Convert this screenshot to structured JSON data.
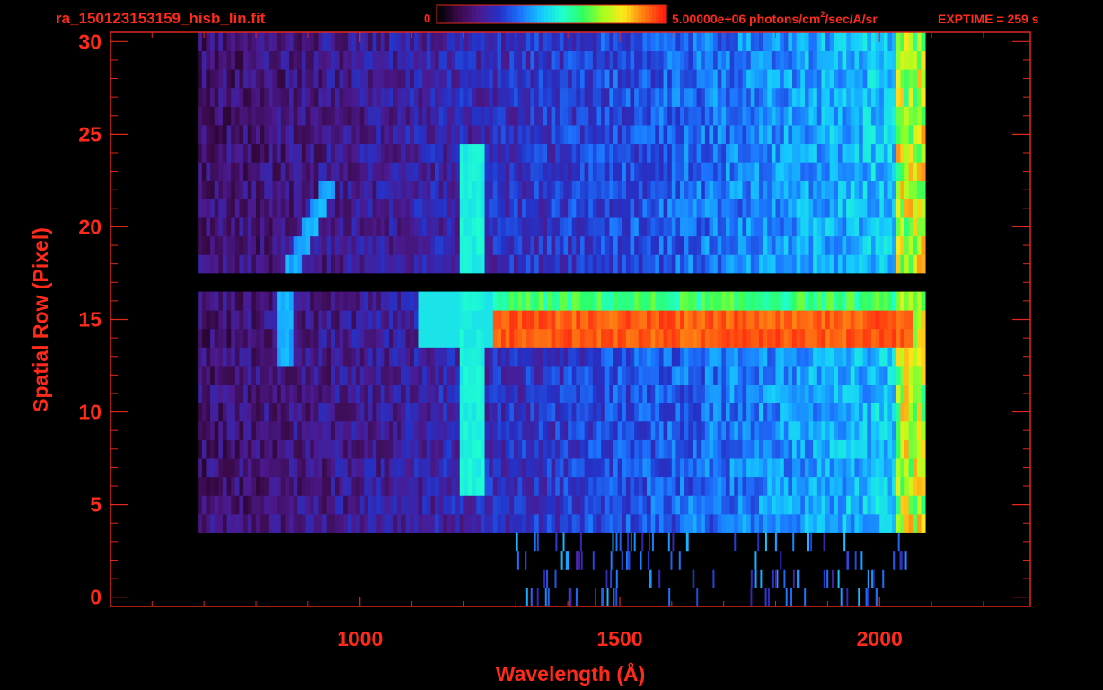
{
  "header": {
    "filename": "ra_150123153159_hisb_lin.fit",
    "colorbar_min_label": "0",
    "colorbar_max_label": "5.00000e+06 photons/cm",
    "colorbar_unit_sup": "2",
    "colorbar_unit_rest": "/sec/A/sr",
    "exptime_label": "EXPTIME = 259 s"
  },
  "colors": {
    "text": "#ff2a1a",
    "axes": "#e0281c",
    "background": "#000000",
    "colormap": [
      "#000000",
      "#3a0a4a",
      "#4b1a90",
      "#2432c8",
      "#1c74ff",
      "#15c8ff",
      "#1fffd0",
      "#2eff62",
      "#a6ff1e",
      "#ffe81a",
      "#ff7a12",
      "#ff1c10"
    ]
  },
  "chart_data": {
    "type": "heatmap",
    "title": "ra_150123153159_hisb_lin.fit",
    "xlabel": "Wavelength (Å)",
    "ylabel": "Spatial Row (Pixel)",
    "xlim": [
      520,
      2290
    ],
    "ylim": [
      -0.5,
      30.5
    ],
    "xticks": [
      1000,
      1500,
      2000
    ],
    "yticks": [
      0,
      5,
      10,
      15,
      20,
      25,
      30
    ],
    "colorbar": {
      "min": 0,
      "max": 5000000,
      "unit": "photons/cm^2/sec/A/sr"
    },
    "exptime_s": 259,
    "data_extent": {
      "wavelength": [
        690,
        2090
      ],
      "rows": [
        4,
        30
      ]
    },
    "features": [
      {
        "type": "emission_line",
        "center": 1216,
        "rows": [
          6,
          24
        ],
        "level": 0.52
      },
      {
        "type": "emission_line_curved",
        "wavelength_range": [
          845,
          955
        ],
        "rows": [
          13,
          22
        ],
        "level": 0.42
      },
      {
        "type": "bright_band",
        "rows": [
          14,
          15
        ],
        "wavelength_range": [
          1260,
          2060
        ],
        "level": 0.98
      },
      {
        "type": "moderate_band",
        "rows": [
          16,
          16
        ],
        "wavelength_range": [
          1260,
          2050
        ],
        "level": 0.62
      },
      {
        "type": "dead_row",
        "rows": [
          17,
          17
        ],
        "level": 0
      },
      {
        "type": "edge_band",
        "wavelength_range": [
          2030,
          2085
        ],
        "rows": [
          1,
          30
        ],
        "level": 0.68
      }
    ]
  }
}
